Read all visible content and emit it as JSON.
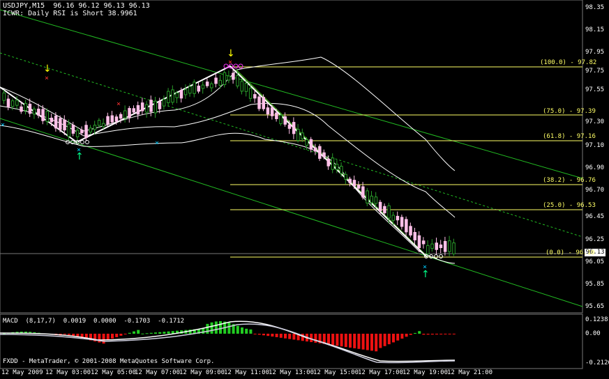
{
  "header": {
    "line1": "USDJPY,M15  96.16 96.12 96.13 96.13",
    "line2": "ICWR: Daily RSI is Short 38.9961"
  },
  "price_axis": [
    "98.35",
    "98.15",
    "97.95",
    "97.75",
    "97.55",
    "97.30",
    "97.10",
    "96.90",
    "96.70",
    "96.45",
    "96.25",
    "96.05",
    "95.85",
    "95.65"
  ],
  "current_price": "96.13",
  "fib_levels": [
    {
      "label": "(100.0) - 97.82"
    },
    {
      "label": "(75.0) - 97.39"
    },
    {
      "label": "(61.8) - 97.16"
    },
    {
      "label": "(38.2) - 96.76"
    },
    {
      "label": "(25.0) - 96.53"
    },
    {
      "label": "(0.0) - 96.10"
    }
  ],
  "macd": {
    "label": "MACD  (8,17,7)  0.0019  0.0000  -0.1703  -0.1712",
    "axis": [
      "0.1238",
      "0.00",
      "-0.2126"
    ]
  },
  "copyright": "FXDD - MetaTrader, © 2001-2008 MetaQuotes Software Corp.",
  "time_axis": [
    "12 May 2009",
    "12 May 03:00",
    "12 May 05:00",
    "12 May 07:00",
    "12 May 09:00",
    "12 May 11:00",
    "12 May 13:00",
    "12 May 15:00",
    "12 May 17:00",
    "12 May 19:00",
    "12 May 21:00"
  ],
  "colors": {
    "background": "#000000",
    "bull": "#2a9d2a",
    "bear": "#ffc0e8",
    "fib": "#ffff66",
    "channel": "#22bb22",
    "bollinger": "#ffffff",
    "zigzag": "#ffffff",
    "macd_pos": "#22cc22",
    "macd_neg": "#ee1111",
    "buy_arrow": "#00ff88",
    "sell_arrow": "#ffff00"
  }
}
